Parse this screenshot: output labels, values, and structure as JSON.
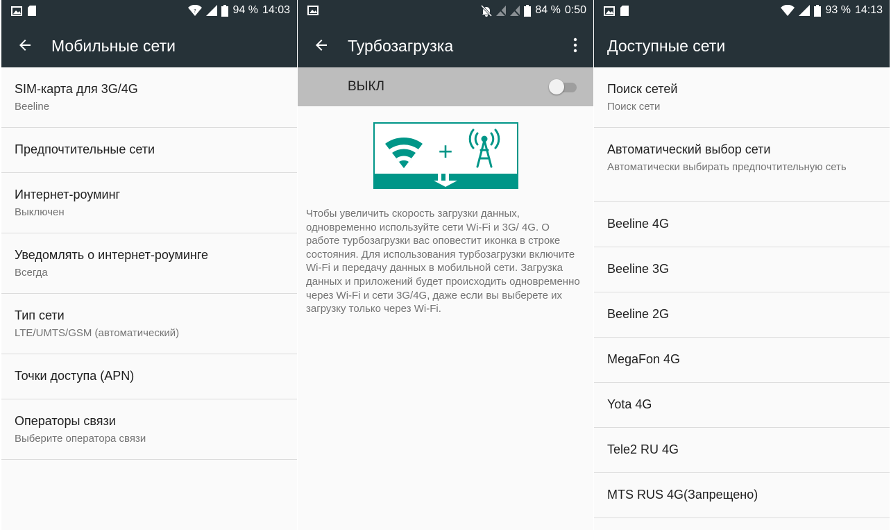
{
  "panel1": {
    "status": {
      "battery": "94 %",
      "time": "14:03"
    },
    "title": "Мобильные сети",
    "items": [
      {
        "title": "SIM-карта для 3G/4G",
        "sub": "Beeline"
      },
      {
        "title": "Предпочтительные сети"
      },
      {
        "title": "Интернет-роуминг",
        "sub": "Выключен"
      },
      {
        "title": "Уведомлять о интернет-роуминге",
        "sub": "Всегда"
      },
      {
        "title": "Тип сети",
        "sub": "LTE/UMTS/GSM (автоматический)"
      },
      {
        "title": "Точки доступа (APN)"
      },
      {
        "title": "Операторы связи",
        "sub": "Выберите оператора связи"
      }
    ]
  },
  "panel2": {
    "status": {
      "battery": "84 %",
      "time": "0:50"
    },
    "title": "Турбозагрузка",
    "toggle": {
      "label": "ВЫКЛ",
      "on": false
    },
    "description": "Чтобы увеличить скорость загрузки данных, одновременно используйте сети Wi-Fi и 3G/ 4G. О работе турбозагрузки вас оповестит иконка в строке состояния. Для использования турбозагрузки включите Wi-Fi и передачу данных в мобильной сети. Загрузка данных и приложений будет происходить одновременно через Wi-Fi и сети 3G/4G, даже если вы выберете их загрузку только через Wi-Fi.",
    "illustration": {
      "plus": "+"
    }
  },
  "panel3": {
    "status": {
      "battery": "93 %",
      "time": "14:13"
    },
    "title": "Доступные сети",
    "items": [
      {
        "title": "Поиск сетей",
        "sub": "Поиск сети"
      },
      {
        "title": "Автоматический выбор сети",
        "sub": "Автоматически выбирать предпочтительную сеть"
      },
      {
        "title": "Beeline 4G"
      },
      {
        "title": "Beeline 3G"
      },
      {
        "title": "Beeline 2G"
      },
      {
        "title": "MegaFon 4G"
      },
      {
        "title": "Yota 4G"
      },
      {
        "title": "Tele2 RU 4G"
      },
      {
        "title": "MTS RUS 4G(Запрещено)"
      }
    ]
  },
  "icons": {
    "back": "back-arrow-icon",
    "more": "more-vert-icon",
    "wifi": "wifi-icon",
    "signal": "signal-icon",
    "battery": "battery-icon",
    "gallery": "gallery-notification-icon",
    "sdcard": "sd-card-icon",
    "mute": "notifications-off-icon"
  },
  "colors": {
    "appbar": "#263238",
    "accent": "#009688",
    "toggle_bar": "#bdbdbd"
  }
}
